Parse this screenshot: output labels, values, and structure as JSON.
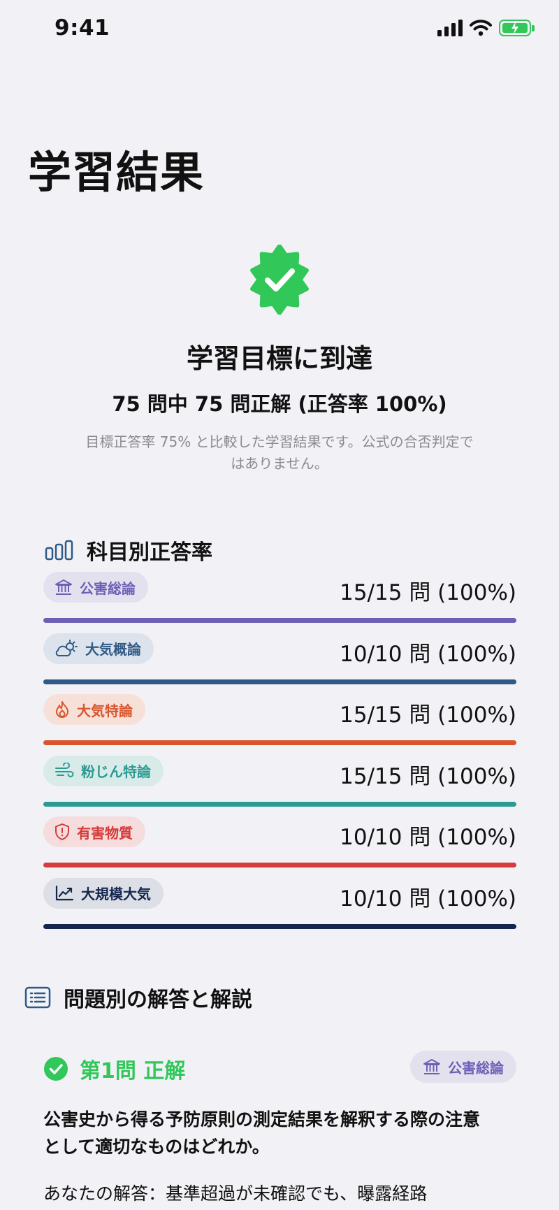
{
  "status_bar": {
    "time": "9:41"
  },
  "page_title": "学習結果",
  "result": {
    "headline": "学習目標に到達",
    "score_line": "75 問中 75 問正解 (正答率 100%)",
    "note": "目標正答率 75% と比較した学習結果です。公式の合否判定ではありません。"
  },
  "subjects_section": {
    "title": "科目別正答率",
    "items": [
      {
        "name": "公害総論",
        "score": "15/15 問 (100%)",
        "icon": "government-building-icon",
        "color": "#6e5fb6",
        "chip_bg": "#e4e1ef",
        "ratio": 1.0
      },
      {
        "name": "大気概論",
        "score": "10/10 問 (100%)",
        "icon": "sun-cloud-icon",
        "color": "#2f5a86",
        "chip_bg": "#dce3ec",
        "ratio": 1.0
      },
      {
        "name": "大気特論",
        "score": "15/15 問 (100%)",
        "icon": "flame-icon",
        "color": "#d9552e",
        "chip_bg": "#f6e0d8",
        "ratio": 1.0
      },
      {
        "name": "粉じん特論",
        "score": "15/15 問 (100%)",
        "icon": "wind-icon",
        "color": "#2a9a92",
        "chip_bg": "#d8ebe9",
        "ratio": 1.0
      },
      {
        "name": "有害物質",
        "score": "10/10 問 (100%)",
        "icon": "shield-alert-icon",
        "color": "#d63b3b",
        "chip_bg": "#f5dcdd",
        "ratio": 1.0
      },
      {
        "name": "大規模大気",
        "score": "10/10 問 (100%)",
        "icon": "trend-chart-icon",
        "color": "#14264f",
        "chip_bg": "#dcdfe6",
        "ratio": 1.0
      }
    ]
  },
  "questions_section": {
    "title": "問題別の解答と解説",
    "first_question": {
      "status": "第1問 正解",
      "subject": "公害総論",
      "subject_color": "#6e5fb6",
      "subject_chip_bg": "#e4e1ef",
      "text": "公害史から得る予防原則の測定結果を解釈する際の注意として適切なものはどれか。",
      "answer": "あなたの解答：基準超過が未確認でも、曝露経路"
    }
  },
  "colors": {
    "success": "#31c759",
    "background": "#f2f2f6"
  }
}
